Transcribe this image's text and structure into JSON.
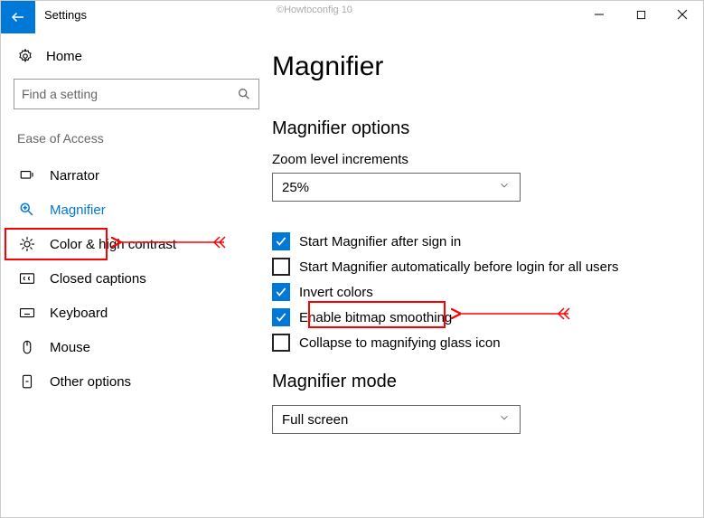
{
  "window": {
    "title": "Settings",
    "watermark": "©Howtoconfig 10",
    "controls": {
      "min": "—",
      "max": "▢",
      "close": "✕"
    }
  },
  "sidebar": {
    "home": "Home",
    "search_placeholder": "Find a setting",
    "category": "Ease of Access",
    "items": [
      {
        "id": "narrator",
        "label": "Narrator"
      },
      {
        "id": "magnifier",
        "label": "Magnifier",
        "active": true
      },
      {
        "id": "color-contrast",
        "label": "Color & high contrast"
      },
      {
        "id": "closed-captions",
        "label": "Closed captions"
      },
      {
        "id": "keyboard",
        "label": "Keyboard"
      },
      {
        "id": "mouse",
        "label": "Mouse"
      },
      {
        "id": "other-options",
        "label": "Other options"
      }
    ]
  },
  "main": {
    "title": "Magnifier",
    "options": {
      "heading": "Magnifier options",
      "zoom_label": "Zoom level increments",
      "zoom_value": "25%",
      "checkboxes": [
        {
          "id": "start-after-signin",
          "label": "Start Magnifier after sign in",
          "checked": true
        },
        {
          "id": "start-before-login",
          "label": "Start Magnifier automatically before login for all users",
          "checked": false
        },
        {
          "id": "invert-colors",
          "label": "Invert colors",
          "checked": true,
          "highlighted": true
        },
        {
          "id": "bitmap-smoothing",
          "label": "Enable bitmap smoothing",
          "checked": true
        },
        {
          "id": "collapse-glass",
          "label": "Collapse to magnifying glass icon",
          "checked": false
        }
      ]
    },
    "mode": {
      "heading": "Magnifier mode",
      "value": "Full screen"
    }
  }
}
